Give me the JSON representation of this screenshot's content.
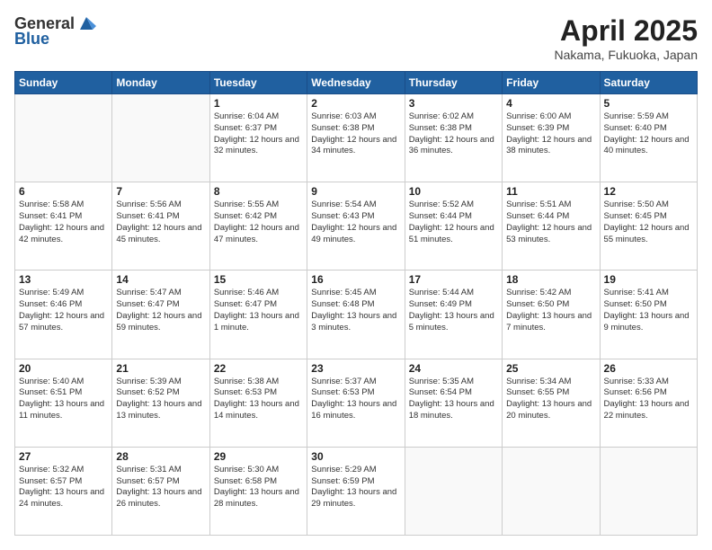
{
  "header": {
    "logo_general": "General",
    "logo_blue": "Blue",
    "month": "April 2025",
    "location": "Nakama, Fukuoka, Japan"
  },
  "weekdays": [
    "Sunday",
    "Monday",
    "Tuesday",
    "Wednesday",
    "Thursday",
    "Friday",
    "Saturday"
  ],
  "weeks": [
    [
      {
        "day": "",
        "info": ""
      },
      {
        "day": "",
        "info": ""
      },
      {
        "day": "1",
        "info": "Sunrise: 6:04 AM\nSunset: 6:37 PM\nDaylight: 12 hours\nand 32 minutes."
      },
      {
        "day": "2",
        "info": "Sunrise: 6:03 AM\nSunset: 6:38 PM\nDaylight: 12 hours\nand 34 minutes."
      },
      {
        "day": "3",
        "info": "Sunrise: 6:02 AM\nSunset: 6:38 PM\nDaylight: 12 hours\nand 36 minutes."
      },
      {
        "day": "4",
        "info": "Sunrise: 6:00 AM\nSunset: 6:39 PM\nDaylight: 12 hours\nand 38 minutes."
      },
      {
        "day": "5",
        "info": "Sunrise: 5:59 AM\nSunset: 6:40 PM\nDaylight: 12 hours\nand 40 minutes."
      }
    ],
    [
      {
        "day": "6",
        "info": "Sunrise: 5:58 AM\nSunset: 6:41 PM\nDaylight: 12 hours\nand 42 minutes."
      },
      {
        "day": "7",
        "info": "Sunrise: 5:56 AM\nSunset: 6:41 PM\nDaylight: 12 hours\nand 45 minutes."
      },
      {
        "day": "8",
        "info": "Sunrise: 5:55 AM\nSunset: 6:42 PM\nDaylight: 12 hours\nand 47 minutes."
      },
      {
        "day": "9",
        "info": "Sunrise: 5:54 AM\nSunset: 6:43 PM\nDaylight: 12 hours\nand 49 minutes."
      },
      {
        "day": "10",
        "info": "Sunrise: 5:52 AM\nSunset: 6:44 PM\nDaylight: 12 hours\nand 51 minutes."
      },
      {
        "day": "11",
        "info": "Sunrise: 5:51 AM\nSunset: 6:44 PM\nDaylight: 12 hours\nand 53 minutes."
      },
      {
        "day": "12",
        "info": "Sunrise: 5:50 AM\nSunset: 6:45 PM\nDaylight: 12 hours\nand 55 minutes."
      }
    ],
    [
      {
        "day": "13",
        "info": "Sunrise: 5:49 AM\nSunset: 6:46 PM\nDaylight: 12 hours\nand 57 minutes."
      },
      {
        "day": "14",
        "info": "Sunrise: 5:47 AM\nSunset: 6:47 PM\nDaylight: 12 hours\nand 59 minutes."
      },
      {
        "day": "15",
        "info": "Sunrise: 5:46 AM\nSunset: 6:47 PM\nDaylight: 13 hours\nand 1 minute."
      },
      {
        "day": "16",
        "info": "Sunrise: 5:45 AM\nSunset: 6:48 PM\nDaylight: 13 hours\nand 3 minutes."
      },
      {
        "day": "17",
        "info": "Sunrise: 5:44 AM\nSunset: 6:49 PM\nDaylight: 13 hours\nand 5 minutes."
      },
      {
        "day": "18",
        "info": "Sunrise: 5:42 AM\nSunset: 6:50 PM\nDaylight: 13 hours\nand 7 minutes."
      },
      {
        "day": "19",
        "info": "Sunrise: 5:41 AM\nSunset: 6:50 PM\nDaylight: 13 hours\nand 9 minutes."
      }
    ],
    [
      {
        "day": "20",
        "info": "Sunrise: 5:40 AM\nSunset: 6:51 PM\nDaylight: 13 hours\nand 11 minutes."
      },
      {
        "day": "21",
        "info": "Sunrise: 5:39 AM\nSunset: 6:52 PM\nDaylight: 13 hours\nand 13 minutes."
      },
      {
        "day": "22",
        "info": "Sunrise: 5:38 AM\nSunset: 6:53 PM\nDaylight: 13 hours\nand 14 minutes."
      },
      {
        "day": "23",
        "info": "Sunrise: 5:37 AM\nSunset: 6:53 PM\nDaylight: 13 hours\nand 16 minutes."
      },
      {
        "day": "24",
        "info": "Sunrise: 5:35 AM\nSunset: 6:54 PM\nDaylight: 13 hours\nand 18 minutes."
      },
      {
        "day": "25",
        "info": "Sunrise: 5:34 AM\nSunset: 6:55 PM\nDaylight: 13 hours\nand 20 minutes."
      },
      {
        "day": "26",
        "info": "Sunrise: 5:33 AM\nSunset: 6:56 PM\nDaylight: 13 hours\nand 22 minutes."
      }
    ],
    [
      {
        "day": "27",
        "info": "Sunrise: 5:32 AM\nSunset: 6:57 PM\nDaylight: 13 hours\nand 24 minutes."
      },
      {
        "day": "28",
        "info": "Sunrise: 5:31 AM\nSunset: 6:57 PM\nDaylight: 13 hours\nand 26 minutes."
      },
      {
        "day": "29",
        "info": "Sunrise: 5:30 AM\nSunset: 6:58 PM\nDaylight: 13 hours\nand 28 minutes."
      },
      {
        "day": "30",
        "info": "Sunrise: 5:29 AM\nSunset: 6:59 PM\nDaylight: 13 hours\nand 29 minutes."
      },
      {
        "day": "",
        "info": ""
      },
      {
        "day": "",
        "info": ""
      },
      {
        "day": "",
        "info": ""
      }
    ]
  ]
}
